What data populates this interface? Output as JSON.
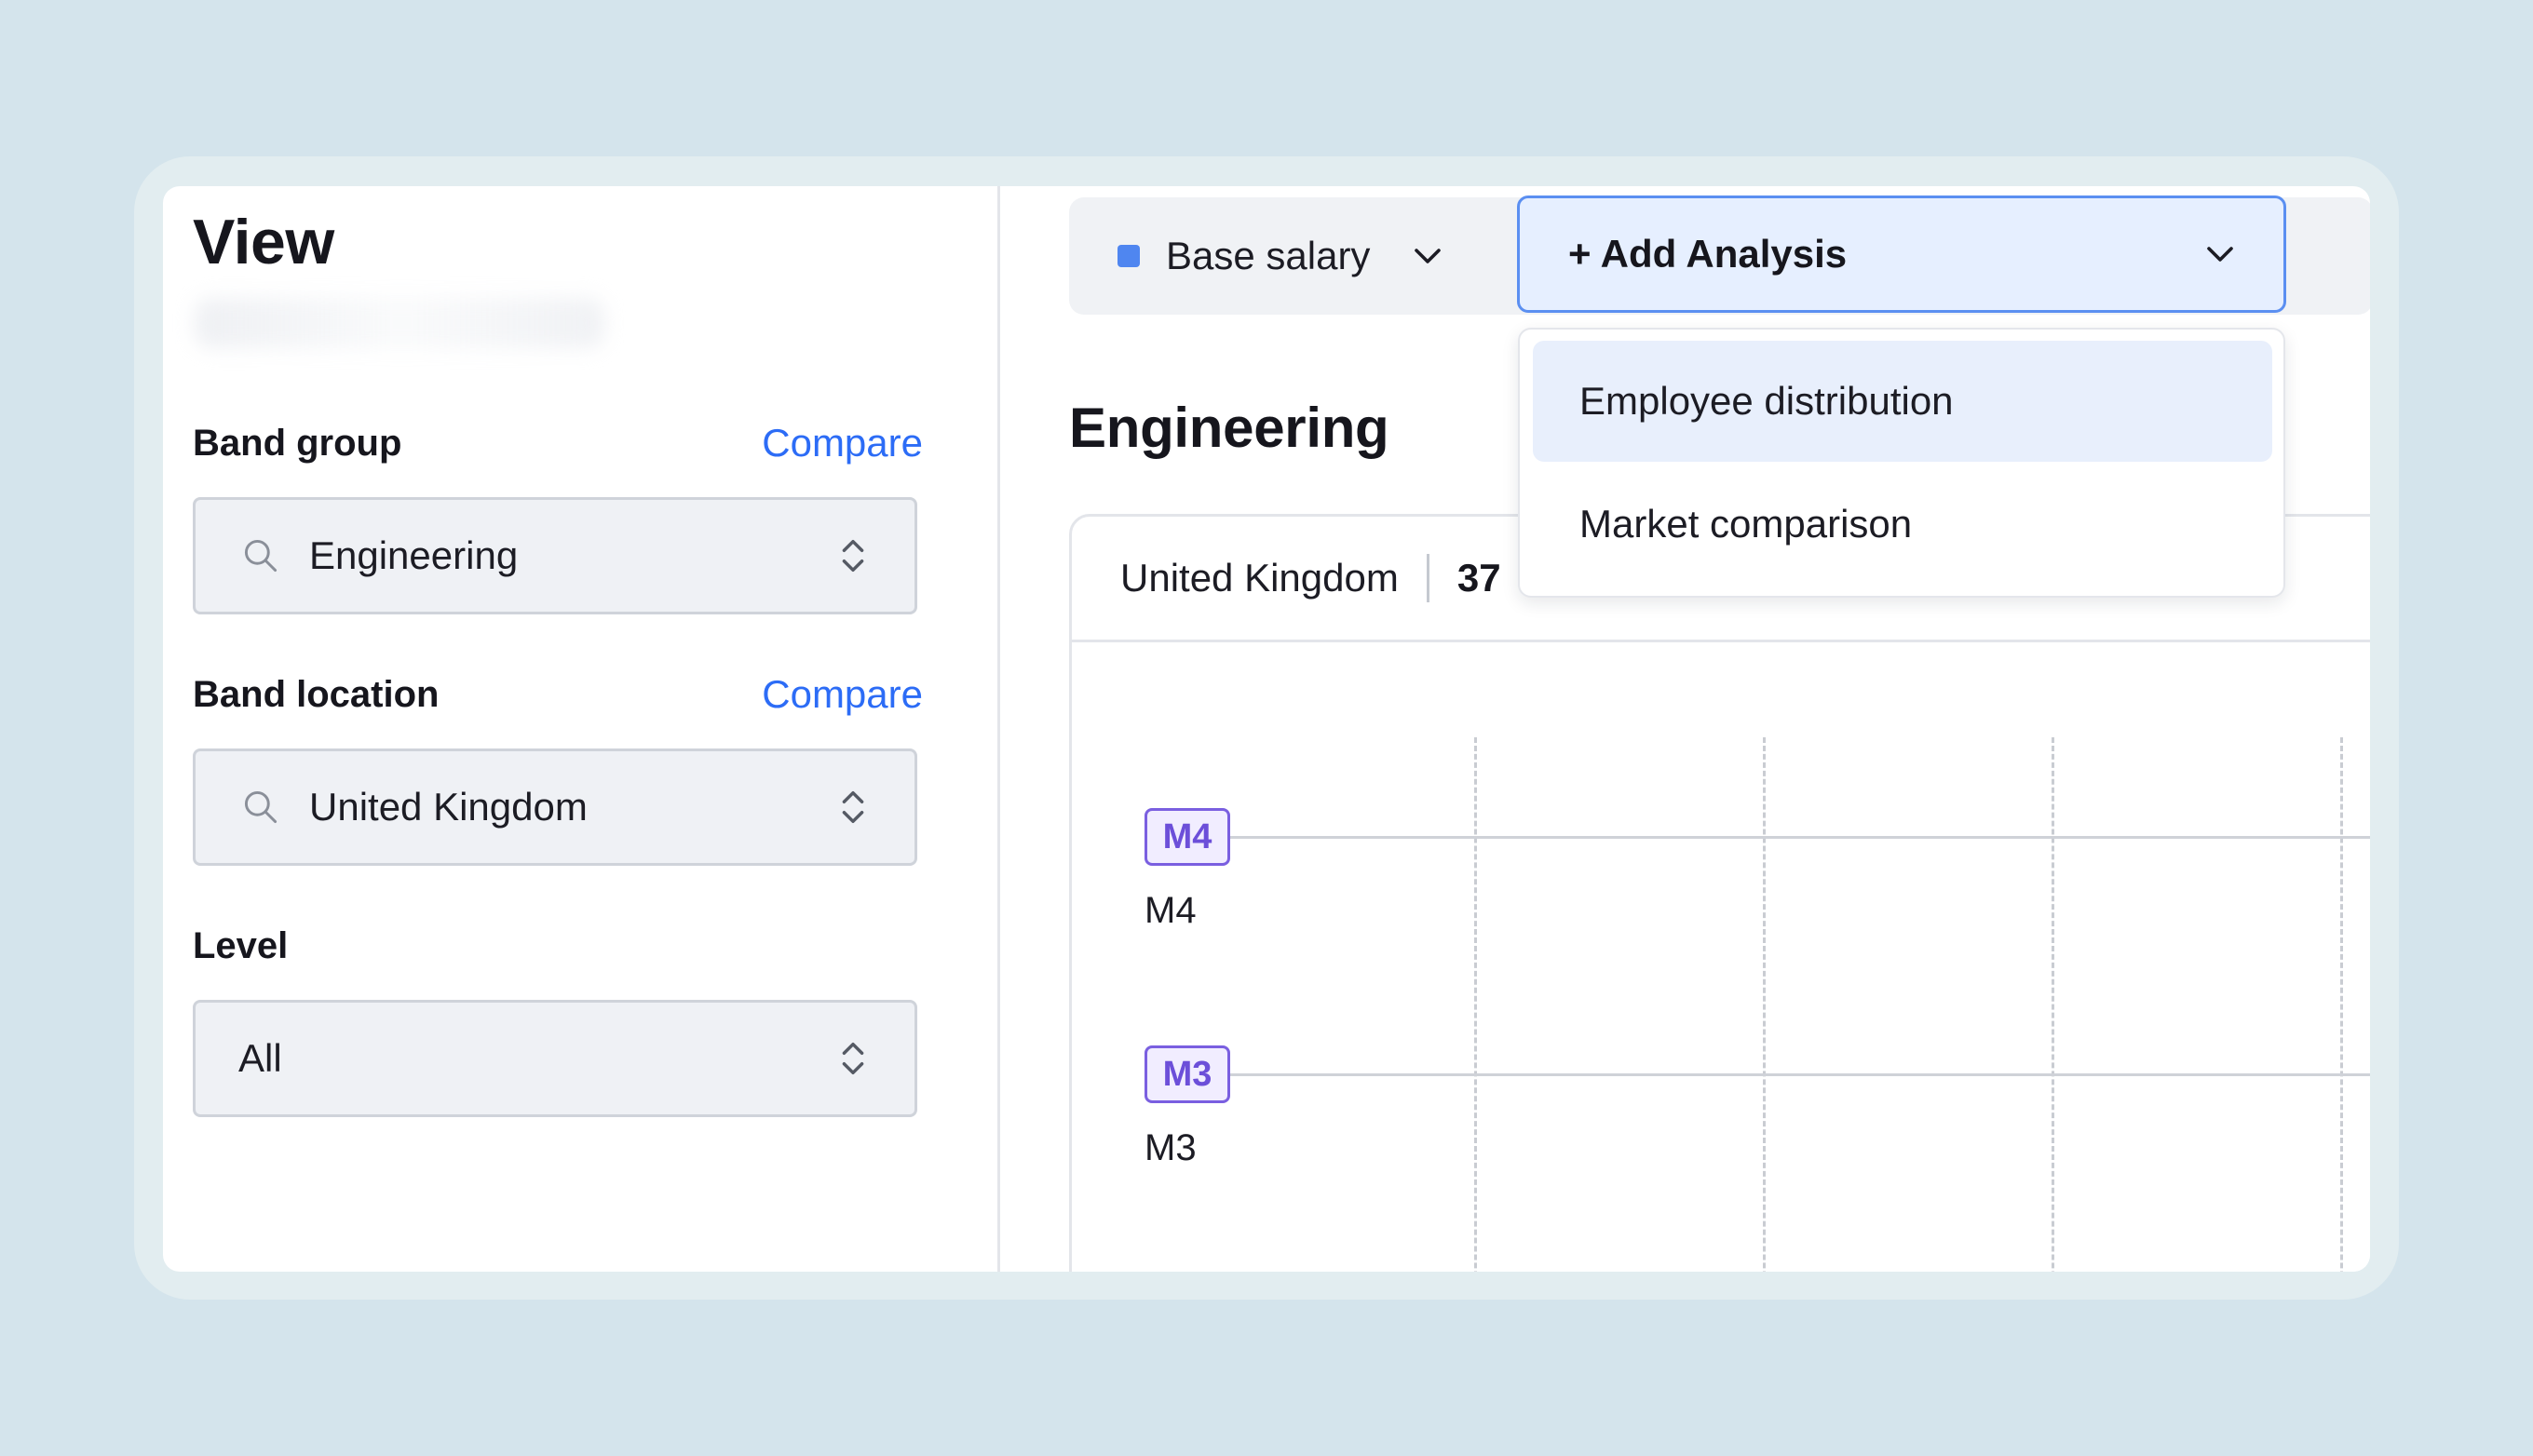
{
  "filters": {
    "title": "View",
    "band_group": {
      "label": "Band group",
      "compare_label": "Compare",
      "value": "Engineering"
    },
    "band_location": {
      "label": "Band location",
      "compare_label": "Compare",
      "value": "United Kingdom"
    },
    "level": {
      "label": "Level",
      "value": "All"
    }
  },
  "toolbar": {
    "metric": {
      "label": "Base salary",
      "color": "#4f86f0"
    },
    "add_analysis": {
      "label": "+ Add Analysis"
    },
    "menu": {
      "items": [
        {
          "label": "Employee distribution",
          "active": true
        },
        {
          "label": "Market comparison",
          "active": false
        }
      ]
    }
  },
  "main": {
    "section_title": "Engineering",
    "card": {
      "location": "United Kingdom",
      "count": "37"
    },
    "levels": [
      {
        "chip": "M4",
        "label": "M4"
      },
      {
        "chip": "M3",
        "label": "M3"
      }
    ]
  }
}
